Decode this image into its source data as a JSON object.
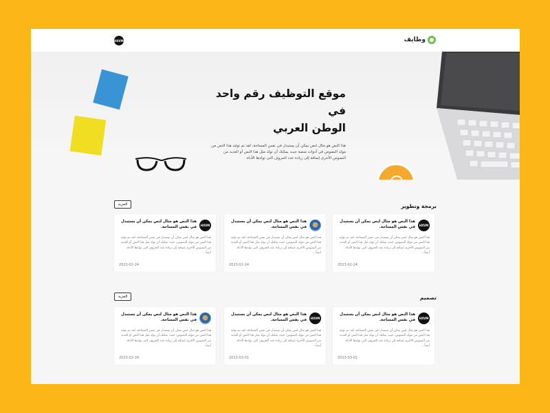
{
  "header": {
    "logo_text": "وظايف",
    "avatar_text": "HXVM"
  },
  "hero": {
    "title_line1": "موقع التوظيف رقم واحد في",
    "title_line2": "الوطن العربي",
    "description": "هذا النص هو مثال لنص يمكن أن يستبدل في نفس المساحة، لقد تم توليد هذا النص من مولد النصوص في أدوات منصة حيث يمكنك أن تولد مثل هذا النص أو العديد من النصوص الأخرى إضافة إلى زيادة عدد الحروف التى تولدها الأداة."
  },
  "sections": [
    {
      "title": "برمجة وتطوير",
      "more_label": "المزيد",
      "cards": [
        {
          "avatar_text": "HXVM",
          "avatar_type": "logo",
          "title": "هذا النص هو مثال لنص يمكن أن يستبدل في نفس المساحة.",
          "body": "هذا النص هو مثال لنص يمكن أن يستبدل في نفس المساحة، لقد تم توليد هذا النص من مولد النصوص، حيث يمكنك أن تولد مثل هذا النص أو العديد من النصوص الأخرى إضافة إلى زيادة عدد الحروف التى تولدها الأداة. أيضاً...",
          "date": "2023-02-24"
        },
        {
          "avatar_text": "",
          "avatar_type": "photo",
          "title": "هذا النص هو مثال لنص يمكن أن يستبدل في نفس المساحة.",
          "body": "هذا النص هو مثال لنص يمكن أن يستبدل في نفس المساحة، لقد تم توليد هذا النص من مولد النصوص، حيث يمكنك أن تولد مثل هذا النص أو العديد من النصوص الأخرى إضافة إلى زيادة عدد الحروف التى تولدها الأداة. أيضاً...",
          "date": "2023-02-24"
        },
        {
          "avatar_text": "HXVM",
          "avatar_type": "logo",
          "title": "هذا النص هو مثال لنص يمكن أن يستبدل في نفس المساحة.",
          "body": "هذا النص هو مثال لنص يمكن أن يستبدل في نفس المساحة، لقد تم توليد هذا النص من مولد النصوص، حيث يمكنك أن تولد مثل هذا النص أو العديد من النصوص الأخرى إضافة إلى زيادة عدد الحروف التى تولدها الأداة. أيضاً...",
          "date": "2023-02-24"
        }
      ]
    },
    {
      "title": "تصميم",
      "more_label": "المزيد",
      "cards": [
        {
          "avatar_text": "HXVM",
          "avatar_type": "logo",
          "title": "هذا النص هو مثال لنص يمكن أن يستبدل في نفس المساحة.",
          "body": "هذا النص هو مثال لنص يمكن أن يستبدل في نفس المساحة، لقد تم توليد هذا النص من مولد النصوص، حيث يمكنك أن تولد مثل هذا النص أو العديد من النصوص الأخرى إضافة إلى زيادة عدد الحروف التى تولدها الأداة. أيضاً...",
          "date": "2023-03-01"
        },
        {
          "avatar_text": "HXVM",
          "avatar_type": "logo",
          "title": "هذا النص هو مثال لنص يمكن أن يستبدل في نفس المساحة.",
          "body": "هذا النص هو مثال لنص يمكن أن يستبدل في نفس المساحة، لقد تم توليد هذا النص من مولد النصوص، حيث يمكنك أن تولد مثل هذا النص أو العديد من النصوص الأخرى إضافة إلى زيادة عدد الحروف التى تولدها الأداة. أيضاً...",
          "date": "2023-03-01"
        },
        {
          "avatar_text": "",
          "avatar_type": "photo",
          "title": "هذا النص هو مثال لنص يمكن أن يستبدل في نفس المساحة.",
          "body": "هذا النص هو مثال لنص يمكن أن يستبدل في نفس المساحة، لقد تم توليد هذا النص من مولد النصوص، حيث يمكنك أن تولد مثل هذا النص أو العديد من النصوص الأخرى إضافة إلى زيادة عدد الحروف التى تولدها الأداة. أيضاً...",
          "date": "2023-02-24"
        }
      ]
    }
  ],
  "colors": {
    "background": "#fbb617",
    "brand_green": "#6cc04a",
    "note_blue": "#3a94d4",
    "note_yellow": "#f0de21",
    "coffee": "#f4a92c"
  }
}
